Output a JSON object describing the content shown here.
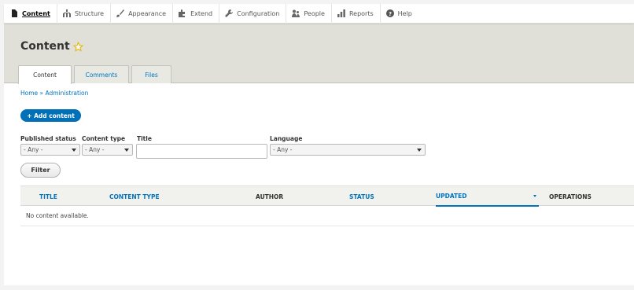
{
  "toolbar": {
    "items": [
      {
        "label": "Content",
        "icon": "file-icon",
        "active": true
      },
      {
        "label": "Structure",
        "icon": "sitemap-icon"
      },
      {
        "label": "Appearance",
        "icon": "paintbrush-icon"
      },
      {
        "label": "Extend",
        "icon": "puzzle-icon"
      },
      {
        "label": "Configuration",
        "icon": "wrench-icon"
      },
      {
        "label": "People",
        "icon": "people-icon"
      },
      {
        "label": "Reports",
        "icon": "bar-chart-icon"
      },
      {
        "label": "Help",
        "icon": "help-icon"
      }
    ]
  },
  "header": {
    "title": "Content",
    "tabs": [
      {
        "label": "Content",
        "active": true
      },
      {
        "label": "Comments"
      },
      {
        "label": "Files"
      }
    ]
  },
  "breadcrumb": "Home » Administration",
  "add_content_label": "+ Add content",
  "filters": {
    "published_status": {
      "label": "Published status",
      "value": "- Any -"
    },
    "content_type": {
      "label": "Content type",
      "value": "- Any -"
    },
    "title": {
      "label": "Title",
      "value": ""
    },
    "language": {
      "label": "Language",
      "value": "- Any -"
    },
    "submit_label": "Filter"
  },
  "table": {
    "columns": [
      "TITLE",
      "CONTENT TYPE",
      "AUTHOR",
      "STATUS",
      "UPDATED",
      "OPERATIONS"
    ],
    "sorted_column": "UPDATED",
    "empty_message": "No content available."
  },
  "colors": {
    "accent": "#0071b8",
    "link": "#0074bd",
    "header_bg": "#e0e0d8"
  }
}
